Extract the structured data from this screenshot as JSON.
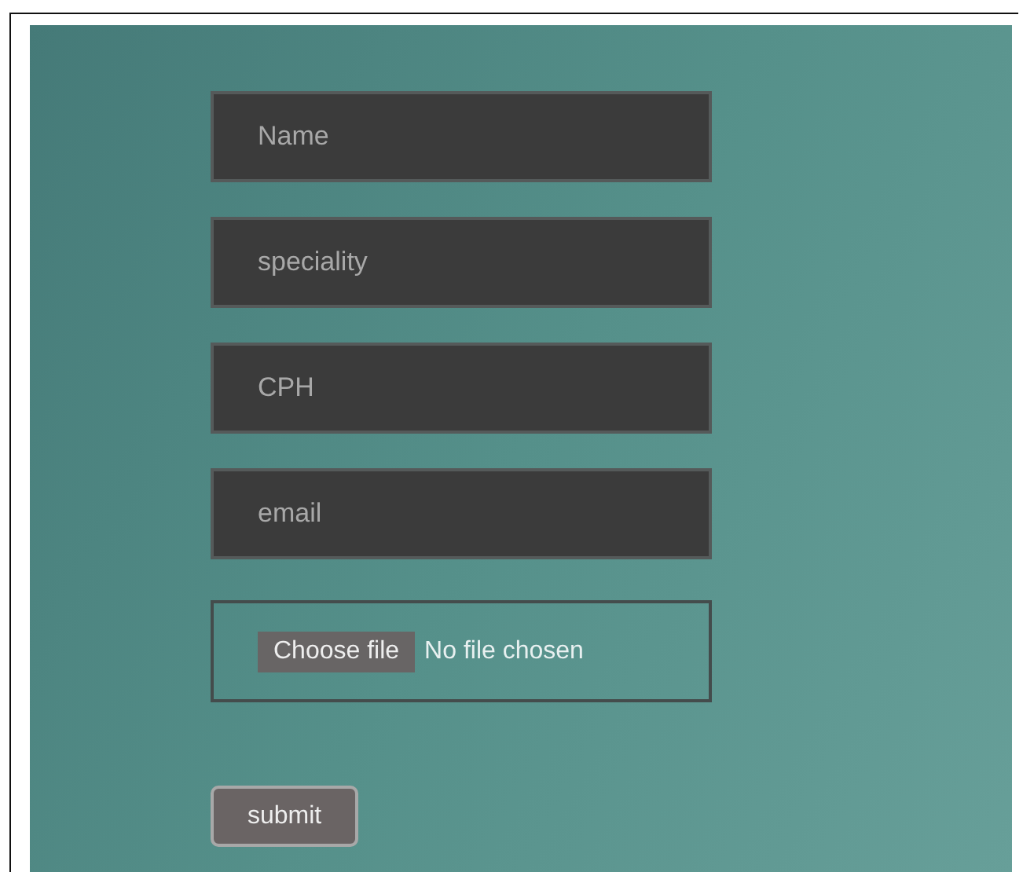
{
  "form": {
    "fields": [
      {
        "placeholder": "Name"
      },
      {
        "placeholder": "speciality"
      },
      {
        "placeholder": "CPH"
      },
      {
        "placeholder": "email"
      }
    ],
    "file_input": {
      "button": "Choose file",
      "status": "No file chosen"
    },
    "submit": "submit"
  }
}
